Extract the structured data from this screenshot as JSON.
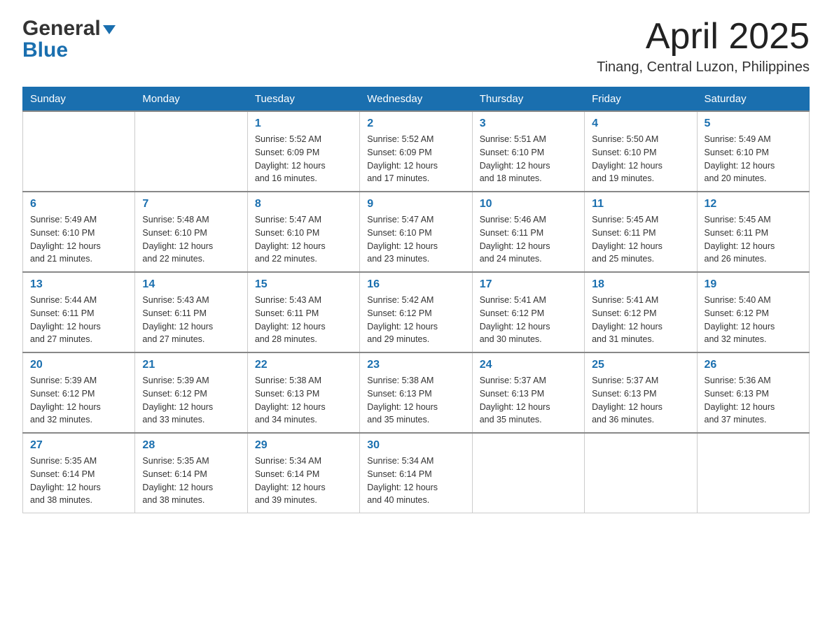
{
  "header": {
    "logo_general": "General",
    "logo_blue": "Blue",
    "month_title": "April 2025",
    "location": "Tinang, Central Luzon, Philippines"
  },
  "days_of_week": [
    "Sunday",
    "Monday",
    "Tuesday",
    "Wednesday",
    "Thursday",
    "Friday",
    "Saturday"
  ],
  "weeks": [
    [
      {
        "day": "",
        "info": ""
      },
      {
        "day": "",
        "info": ""
      },
      {
        "day": "1",
        "info": "Sunrise: 5:52 AM\nSunset: 6:09 PM\nDaylight: 12 hours\nand 16 minutes."
      },
      {
        "day": "2",
        "info": "Sunrise: 5:52 AM\nSunset: 6:09 PM\nDaylight: 12 hours\nand 17 minutes."
      },
      {
        "day": "3",
        "info": "Sunrise: 5:51 AM\nSunset: 6:10 PM\nDaylight: 12 hours\nand 18 minutes."
      },
      {
        "day": "4",
        "info": "Sunrise: 5:50 AM\nSunset: 6:10 PM\nDaylight: 12 hours\nand 19 minutes."
      },
      {
        "day": "5",
        "info": "Sunrise: 5:49 AM\nSunset: 6:10 PM\nDaylight: 12 hours\nand 20 minutes."
      }
    ],
    [
      {
        "day": "6",
        "info": "Sunrise: 5:49 AM\nSunset: 6:10 PM\nDaylight: 12 hours\nand 21 minutes."
      },
      {
        "day": "7",
        "info": "Sunrise: 5:48 AM\nSunset: 6:10 PM\nDaylight: 12 hours\nand 22 minutes."
      },
      {
        "day": "8",
        "info": "Sunrise: 5:47 AM\nSunset: 6:10 PM\nDaylight: 12 hours\nand 22 minutes."
      },
      {
        "day": "9",
        "info": "Sunrise: 5:47 AM\nSunset: 6:10 PM\nDaylight: 12 hours\nand 23 minutes."
      },
      {
        "day": "10",
        "info": "Sunrise: 5:46 AM\nSunset: 6:11 PM\nDaylight: 12 hours\nand 24 minutes."
      },
      {
        "day": "11",
        "info": "Sunrise: 5:45 AM\nSunset: 6:11 PM\nDaylight: 12 hours\nand 25 minutes."
      },
      {
        "day": "12",
        "info": "Sunrise: 5:45 AM\nSunset: 6:11 PM\nDaylight: 12 hours\nand 26 minutes."
      }
    ],
    [
      {
        "day": "13",
        "info": "Sunrise: 5:44 AM\nSunset: 6:11 PM\nDaylight: 12 hours\nand 27 minutes."
      },
      {
        "day": "14",
        "info": "Sunrise: 5:43 AM\nSunset: 6:11 PM\nDaylight: 12 hours\nand 27 minutes."
      },
      {
        "day": "15",
        "info": "Sunrise: 5:43 AM\nSunset: 6:11 PM\nDaylight: 12 hours\nand 28 minutes."
      },
      {
        "day": "16",
        "info": "Sunrise: 5:42 AM\nSunset: 6:12 PM\nDaylight: 12 hours\nand 29 minutes."
      },
      {
        "day": "17",
        "info": "Sunrise: 5:41 AM\nSunset: 6:12 PM\nDaylight: 12 hours\nand 30 minutes."
      },
      {
        "day": "18",
        "info": "Sunrise: 5:41 AM\nSunset: 6:12 PM\nDaylight: 12 hours\nand 31 minutes."
      },
      {
        "day": "19",
        "info": "Sunrise: 5:40 AM\nSunset: 6:12 PM\nDaylight: 12 hours\nand 32 minutes."
      }
    ],
    [
      {
        "day": "20",
        "info": "Sunrise: 5:39 AM\nSunset: 6:12 PM\nDaylight: 12 hours\nand 32 minutes."
      },
      {
        "day": "21",
        "info": "Sunrise: 5:39 AM\nSunset: 6:12 PM\nDaylight: 12 hours\nand 33 minutes."
      },
      {
        "day": "22",
        "info": "Sunrise: 5:38 AM\nSunset: 6:13 PM\nDaylight: 12 hours\nand 34 minutes."
      },
      {
        "day": "23",
        "info": "Sunrise: 5:38 AM\nSunset: 6:13 PM\nDaylight: 12 hours\nand 35 minutes."
      },
      {
        "day": "24",
        "info": "Sunrise: 5:37 AM\nSunset: 6:13 PM\nDaylight: 12 hours\nand 35 minutes."
      },
      {
        "day": "25",
        "info": "Sunrise: 5:37 AM\nSunset: 6:13 PM\nDaylight: 12 hours\nand 36 minutes."
      },
      {
        "day": "26",
        "info": "Sunrise: 5:36 AM\nSunset: 6:13 PM\nDaylight: 12 hours\nand 37 minutes."
      }
    ],
    [
      {
        "day": "27",
        "info": "Sunrise: 5:35 AM\nSunset: 6:14 PM\nDaylight: 12 hours\nand 38 minutes."
      },
      {
        "day": "28",
        "info": "Sunrise: 5:35 AM\nSunset: 6:14 PM\nDaylight: 12 hours\nand 38 minutes."
      },
      {
        "day": "29",
        "info": "Sunrise: 5:34 AM\nSunset: 6:14 PM\nDaylight: 12 hours\nand 39 minutes."
      },
      {
        "day": "30",
        "info": "Sunrise: 5:34 AM\nSunset: 6:14 PM\nDaylight: 12 hours\nand 40 minutes."
      },
      {
        "day": "",
        "info": ""
      },
      {
        "day": "",
        "info": ""
      },
      {
        "day": "",
        "info": ""
      }
    ]
  ]
}
